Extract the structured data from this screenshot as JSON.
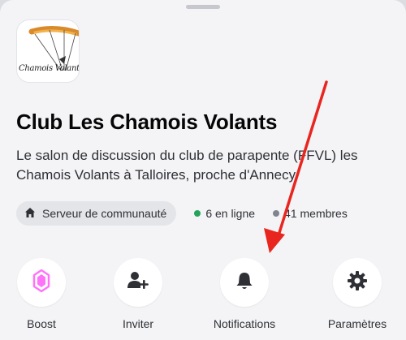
{
  "server": {
    "logo_text": "Chamois Volants",
    "name": "Club Les Chamois Volants",
    "description": "Le salon de discussion du club de parapente (FFVL) les Chamois Volants à Talloires, proche d'Annecy."
  },
  "meta": {
    "community_label": "Serveur de communauté",
    "online": "6 en ligne",
    "members": "41 membres",
    "online_color": "#23a55a",
    "members_color": "#80848e"
  },
  "actions": {
    "boost": "Boost",
    "invite": "Inviter",
    "notifications": "Notifications",
    "settings": "Paramètres"
  },
  "icons": {
    "community": "home-icon",
    "boost": "boost-gem-icon",
    "invite": "add-user-icon",
    "notifications": "bell-icon",
    "settings": "gear-icon",
    "annotation": "red-arrow"
  },
  "colors": {
    "boost_accent": "#ff73fa",
    "annotation_arrow": "#e8261f"
  }
}
